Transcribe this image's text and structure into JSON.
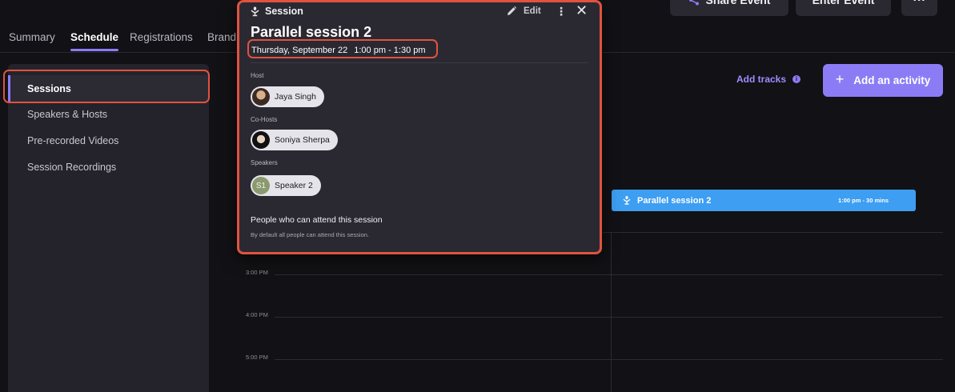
{
  "header": {
    "share_event_label": "Share Event",
    "enter_event_label": "Enter Event",
    "more_label": "···"
  },
  "tabs": [
    {
      "label": "Summary"
    },
    {
      "label": "Schedule",
      "active": true
    },
    {
      "label": "Registrations"
    },
    {
      "label": "Brand"
    }
  ],
  "sidebar": {
    "items": [
      {
        "label": "Sessions",
        "active": true
      },
      {
        "label": "Speakers & Hosts"
      },
      {
        "label": "Pre-recorded Videos"
      },
      {
        "label": "Session Recordings"
      }
    ]
  },
  "toolbar": {
    "add_tracks_label": "Add tracks",
    "add_activity_label": "Add an activity"
  },
  "schedule": {
    "time_labels": [
      "3:00 PM",
      "4:00 PM",
      "5:00 PM"
    ],
    "session_block": {
      "name": "Parallel session 2",
      "time": "1:00 pm - 30 mins"
    }
  },
  "popup": {
    "type_label": "Session",
    "edit_label": "Edit",
    "title": "Parallel session 2",
    "date": "Thursday, September 22",
    "time": "1:00 pm - 1:30 pm",
    "host_label": "Host",
    "host": "Jaya Singh",
    "cohosts_label": "Co-Hosts",
    "cohost": "Soniya Sherpa",
    "speakers_label": "Speakers",
    "speaker_initials": "S1",
    "speaker": "Speaker 2",
    "attend_title": "People who can attend this session",
    "attend_sub": "By default all people can attend this session."
  },
  "colors": {
    "accent": "#8b7cf6",
    "highlight": "#e0533f",
    "session_block": "#3d9ef2",
    "background": "#121115"
  },
  "icons": [
    "share-icon",
    "session-icon",
    "edit-pencil-icon",
    "kebab-menu-icon",
    "close-icon",
    "info-icon",
    "plus-icon"
  ]
}
